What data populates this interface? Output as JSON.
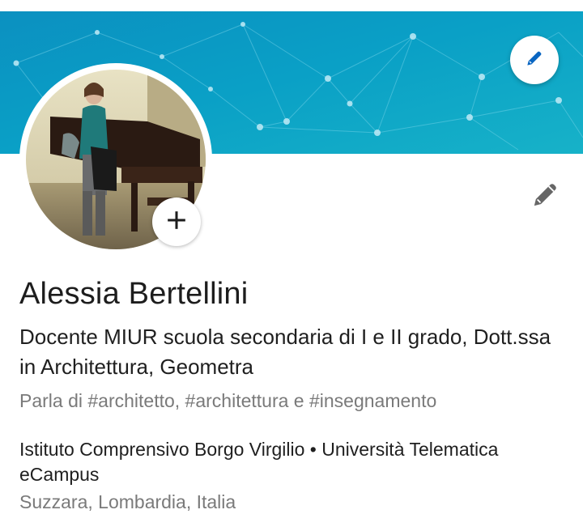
{
  "profile": {
    "name": "Alessia Bertellini",
    "headline": "Docente MIUR scuola secondaria di I e II grado, Dott.ssa in Architettura, Geometra",
    "topics": "Parla di #architetto, #architettura e #insegnamento",
    "education": "Istituto Comprensivo Borgo Virgilio • Università Telematica eCampus",
    "location": "Suzzara, Lombardia, Italia"
  },
  "icons": {
    "banner_edit": "pencil-icon",
    "intro_edit": "pencil-icon",
    "add_photo": "plus-icon"
  },
  "colors": {
    "banner_blue": "#0a95c2",
    "banner_teal": "#1ab0c7",
    "icon_blue": "#0a66c2",
    "text_primary": "#1d1d1d",
    "text_secondary": "#7a7a7a"
  }
}
